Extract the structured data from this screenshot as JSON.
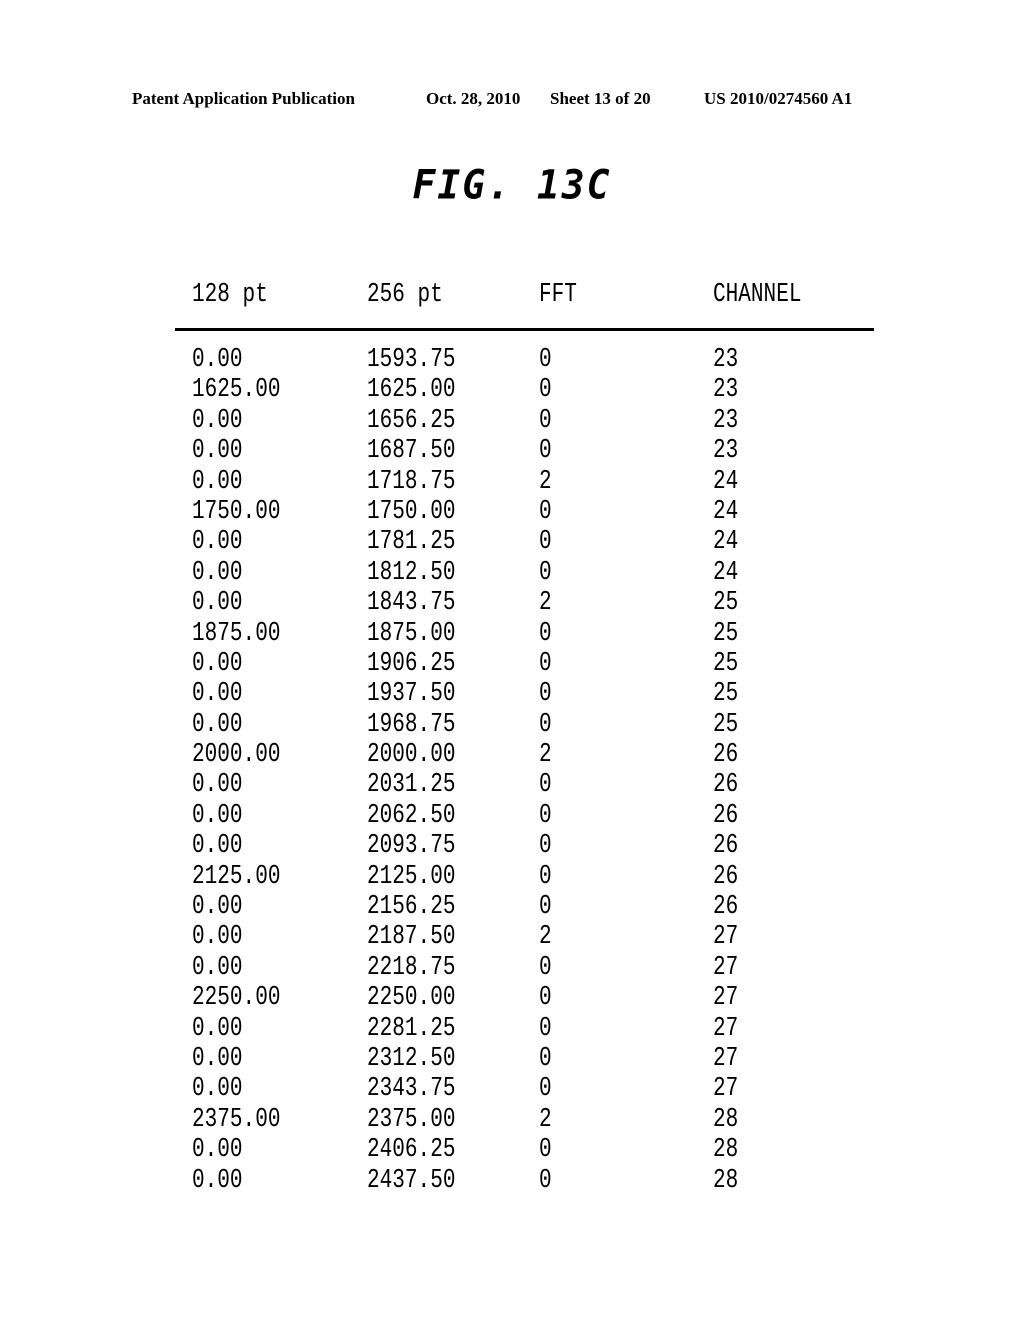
{
  "header": {
    "publication": "Patent Application Publication",
    "date": "Oct. 28, 2010",
    "sheet": "Sheet 13 of 20",
    "number": "US 2010/0274560 A1"
  },
  "figure": {
    "title": "FIG. 13C"
  },
  "table": {
    "columns": [
      "128 pt",
      "256 pt",
      "FFT",
      "CHANNEL"
    ],
    "rows": [
      [
        "0.00",
        "1593.75",
        "0",
        "23"
      ],
      [
        "1625.00",
        "1625.00",
        "0",
        "23"
      ],
      [
        "0.00",
        "1656.25",
        "0",
        "23"
      ],
      [
        "0.00",
        "1687.50",
        "0",
        "23"
      ],
      [
        "0.00",
        "1718.75",
        "2",
        "24"
      ],
      [
        "1750.00",
        "1750.00",
        "0",
        "24"
      ],
      [
        "0.00",
        "1781.25",
        "0",
        "24"
      ],
      [
        "0.00",
        "1812.50",
        "0",
        "24"
      ],
      [
        "0.00",
        "1843.75",
        "2",
        "25"
      ],
      [
        "1875.00",
        "1875.00",
        "0",
        "25"
      ],
      [
        "0.00",
        "1906.25",
        "0",
        "25"
      ],
      [
        "0.00",
        "1937.50",
        "0",
        "25"
      ],
      [
        "0.00",
        "1968.75",
        "0",
        "25"
      ],
      [
        "2000.00",
        "2000.00",
        "2",
        "26"
      ],
      [
        "0.00",
        "2031.25",
        "0",
        "26"
      ],
      [
        "0.00",
        "2062.50",
        "0",
        "26"
      ],
      [
        "0.00",
        "2093.75",
        "0",
        "26"
      ],
      [
        "2125.00",
        "2125.00",
        "0",
        "26"
      ],
      [
        "0.00",
        "2156.25",
        "0",
        "26"
      ],
      [
        "0.00",
        "2187.50",
        "2",
        "27"
      ],
      [
        "0.00",
        "2218.75",
        "0",
        "27"
      ],
      [
        "2250.00",
        "2250.00",
        "0",
        "27"
      ],
      [
        "0.00",
        "2281.25",
        "0",
        "27"
      ],
      [
        "0.00",
        "2312.50",
        "0",
        "27"
      ],
      [
        "0.00",
        "2343.75",
        "0",
        "27"
      ],
      [
        "2375.00",
        "2375.00",
        "2",
        "28"
      ],
      [
        "0.00",
        "2406.25",
        "0",
        "28"
      ],
      [
        "0.00",
        "2437.50",
        "0",
        "28"
      ]
    ]
  }
}
